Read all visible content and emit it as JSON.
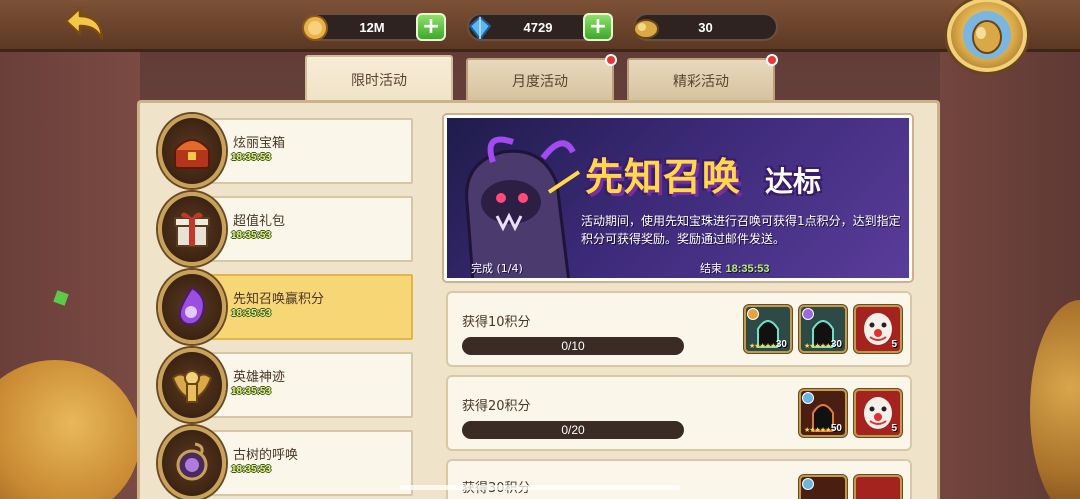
{
  "resources": {
    "gold": {
      "icon": "gold-coin-icon",
      "value": "12M"
    },
    "gems": {
      "icon": "diamond-icon",
      "value": "4729"
    },
    "tokens": {
      "icon": "summon-scroll-icon",
      "value": "30"
    }
  },
  "tabs": [
    {
      "label": "限时活动",
      "active": true,
      "notify": false
    },
    {
      "label": "月度活动",
      "active": false,
      "notify": true
    },
    {
      "label": "精彩活动",
      "active": false,
      "notify": true
    }
  ],
  "sidebar": {
    "items": [
      {
        "name": "炫丽宝箱",
        "time": "18:35:53",
        "icon": "treasure-chest-icon",
        "active": false
      },
      {
        "name": "超值礼包",
        "time": "18:35:53",
        "icon": "gift-box-icon",
        "active": false
      },
      {
        "name": "先知召唤赢积分",
        "time": "18:35:53",
        "icon": "prophet-orb-icon",
        "active": true
      },
      {
        "name": "英雄神迹",
        "time": "18:35:53",
        "icon": "golden-angel-icon",
        "active": false
      },
      {
        "name": "古树的呼唤",
        "time": "18:35:53",
        "icon": "ancient-tree-icon",
        "active": false
      }
    ]
  },
  "banner": {
    "title": "先知召唤",
    "title_suffix": "达标",
    "description": "活动期间，使用先知宝珠进行召唤可获得1点积分，达到指定积分可获得奖励。奖励通过邮件发送。",
    "progress": "完成 (1/4)",
    "end_label": "结束",
    "end_time": "18:35:53"
  },
  "tasks": [
    {
      "label": "获得10积分",
      "progress": "0/10",
      "rewards": [
        {
          "type": "hero-shard",
          "icon": "hero-shard-icon",
          "count": "30",
          "stars": "★★★★★"
        },
        {
          "type": "hero-shard",
          "icon": "hero-shard-icon",
          "count": "30",
          "stars": "★★★★★"
        },
        {
          "type": "clown-mask",
          "icon": "clown-mask-icon",
          "count": "5"
        }
      ]
    },
    {
      "label": "获得20积分",
      "progress": "0/20",
      "rewards": [
        {
          "type": "hero-shard-red",
          "icon": "hero-shard-icon",
          "count": "50",
          "stars": "★★★★★"
        },
        {
          "type": "clown-mask",
          "icon": "clown-mask-icon",
          "count": "5"
        }
      ]
    },
    {
      "label": "获得30积分",
      "progress": "",
      "rewards": []
    }
  ]
}
